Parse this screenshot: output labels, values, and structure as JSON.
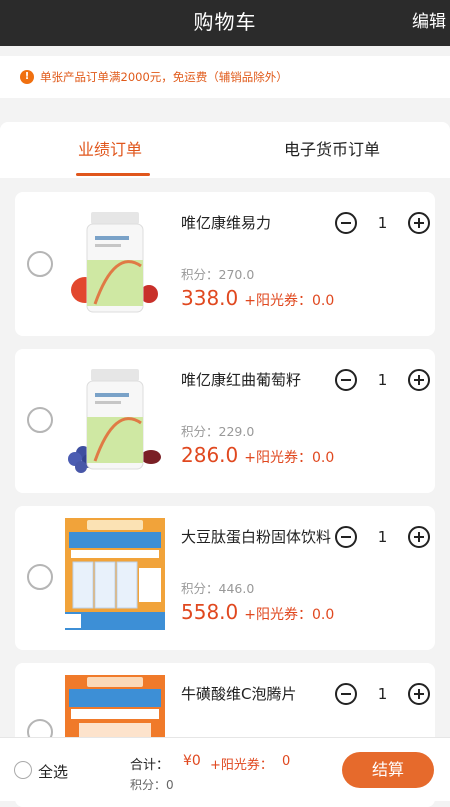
{
  "header": {
    "title": "购物车",
    "edit_label": "编辑"
  },
  "notice": {
    "icon": "!",
    "text": "单张产品订单满2000元，免运费（辅销品除外）"
  },
  "tabs": [
    {
      "label": "业绩订单",
      "active": true
    },
    {
      "label": "电子货币订单",
      "active": false
    }
  ],
  "items": [
    {
      "name": "唯亿康维易力",
      "qty": "1",
      "points_label": "积分：270.0",
      "price": "338.0",
      "sun_label": "+阳光券：0.0"
    },
    {
      "name": "唯亿康红曲葡萄籽",
      "qty": "1",
      "points_label": "积分：229.0",
      "price": "286.0",
      "sun_label": "+阳光券：0.0"
    },
    {
      "name": "大豆肽蛋白粉固体饮料",
      "qty": "1",
      "points_label": "积分：446.0",
      "price": "558.0",
      "sun_label": "+阳光券：0.0"
    },
    {
      "name": "牛磺酸维C泡腾片",
      "qty": "1",
      "points_label": "",
      "price": "",
      "sun_label": ""
    }
  ],
  "footer": {
    "select_all_label": "全选",
    "total_label": "合计：",
    "total_value": "¥0",
    "sun_label": "+阳光券：",
    "sun_value": "0",
    "points_label": "积分：0",
    "checkout_label": "结算"
  },
  "colors": {
    "accent": "#e0561c",
    "price": "#e0481f",
    "header_bg": "#2b2b2b"
  }
}
